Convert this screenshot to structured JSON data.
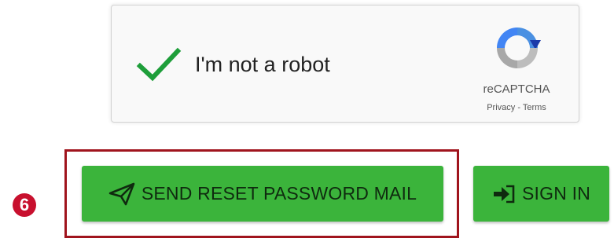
{
  "recaptcha": {
    "label": "I'm not a robot",
    "checked": true,
    "brand": "reCAPTCHA",
    "privacy_link": "Privacy",
    "separator": " - ",
    "terms_link": "Terms"
  },
  "step_badge": "6",
  "buttons": {
    "send_reset_label": "SEND RESET PASSWORD MAIL",
    "send_reset_icon": "paper-plane-icon",
    "signin_label": "SIGN IN",
    "signin_icon": "sign-in-icon"
  },
  "colors": {
    "button_green": "#3bb43b",
    "highlight_red": "#a0141d",
    "badge_red": "#c8102e",
    "check_green": "#1e9e3a"
  }
}
